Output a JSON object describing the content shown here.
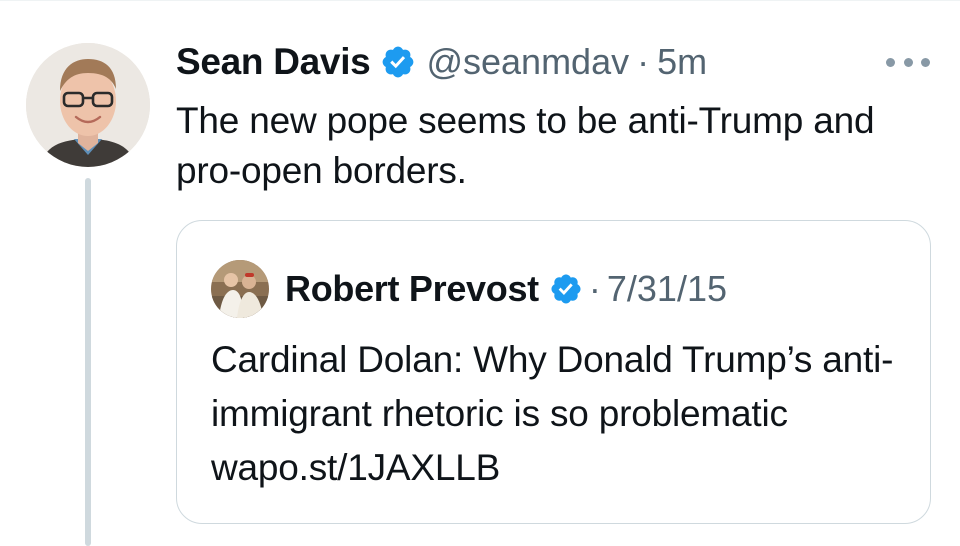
{
  "tweet": {
    "author": {
      "display_name": "Sean Davis",
      "handle": "@seanmdav",
      "verified": true,
      "avatar": "profile-photo"
    },
    "separator": "·",
    "timestamp": "5m",
    "more_icon": "more-horizontal-icon",
    "text": "The new pope seems to be anti-Trump and pro-open borders.",
    "quote": {
      "author": {
        "display_name": "Robert Prevost",
        "verified": true,
        "avatar": "profile-photo"
      },
      "separator": "·",
      "date": "7/31/15",
      "text": "Cardinal Dolan: Why Donald Trump’s anti-immigrant rhetoric is so problematic wapo.st/1JAXLLB"
    }
  },
  "colors": {
    "verified_blue": "#1d9bf0",
    "text_primary": "#0f1419",
    "text_secondary": "#536471",
    "border": "#cfd9de",
    "thread_line": "#cfd9de"
  }
}
